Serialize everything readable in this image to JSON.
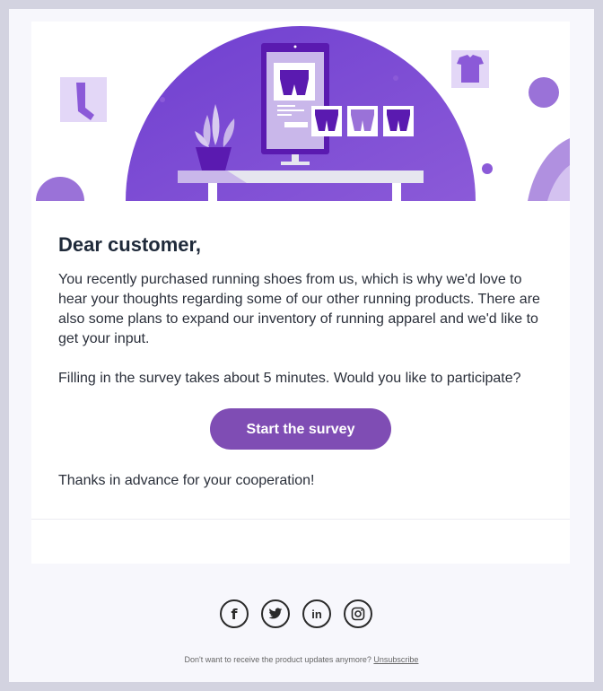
{
  "email": {
    "greeting": "Dear customer,",
    "paragraph1": "You recently purchased running shoes from us, which is why we'd love to hear your thoughts regarding some of our other running products. There are also some plans to expand our inventory of running apparel and we'd like to get your input.",
    "paragraph2": "Filling in the survey takes about 5 minutes. Would you like to participate?",
    "cta_label": "Start the survey",
    "thanks": "Thanks in advance for your cooperation!"
  },
  "social": {
    "icons": [
      "facebook-icon",
      "twitter-icon",
      "linkedin-icon",
      "instagram-icon"
    ],
    "facebook_glyph": "f",
    "linkedin_glyph": "in"
  },
  "footer": {
    "text": "Don't want to receive the product updates anymore?",
    "unsubscribe_label": "Unsubscribe"
  },
  "colors": {
    "accent": "#7f4db4",
    "hero_purple": "#7a48d0",
    "background": "#f7f7fc"
  }
}
